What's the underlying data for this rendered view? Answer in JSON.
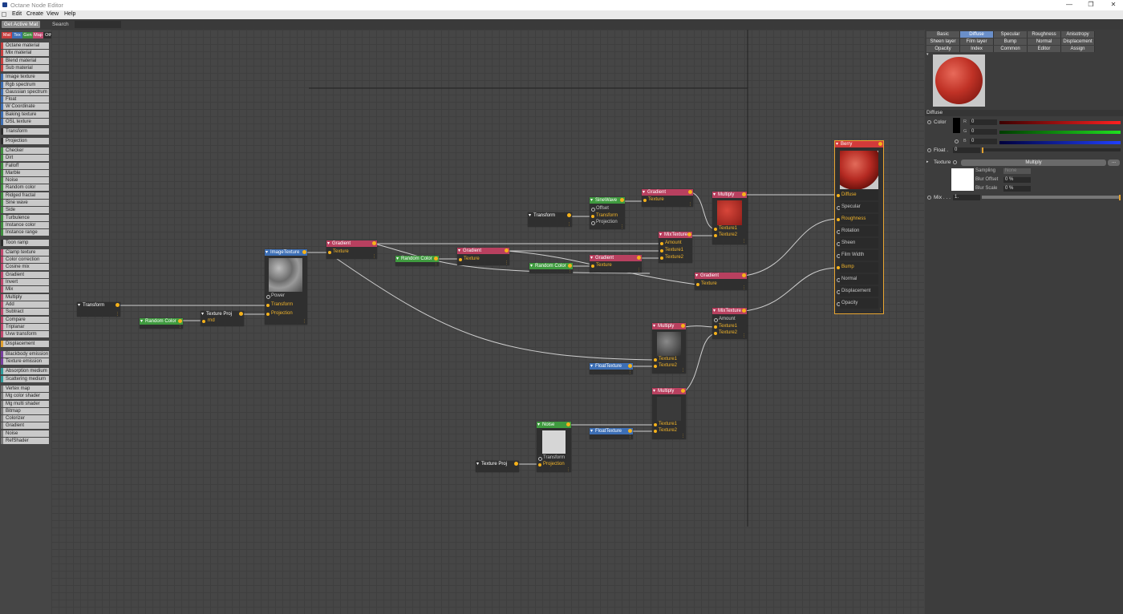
{
  "window": {
    "title": "Octane Node Editor",
    "controls": [
      "—",
      "❐",
      "✕"
    ]
  },
  "menubar": [
    "Edit",
    "Create",
    "View",
    "Help"
  ],
  "toolbar": {
    "get_active_label": "Get Active Mat",
    "search_label": "Search",
    "search_value": ""
  },
  "categories": [
    {
      "label": "Mat",
      "color": "#c94040"
    },
    {
      "label": "Tex",
      "color": "#3d6fb5"
    },
    {
      "label": "Gen",
      "color": "#3f8f3f"
    },
    {
      "label": "Map",
      "color": "#c0486e"
    },
    {
      "label": "Oth",
      "color": "#2c2c2c"
    },
    {
      "label": "Ems",
      "color": "#7a3fa0"
    },
    {
      "label": "Med",
      "color": "#2f9a9a"
    },
    {
      "label": "C4D",
      "color": "#7a7a7a"
    }
  ],
  "palette": [
    {
      "label": "Octane material",
      "color": "#c94040"
    },
    {
      "label": "Mix material",
      "color": "#c94040"
    },
    {
      "label": "Blend material",
      "color": "#c94040"
    },
    {
      "label": "Sub material",
      "color": "#c94040"
    },
    {
      "label": "Image texture",
      "color": "#3d6fb5"
    },
    {
      "label": "Rgb spectrum",
      "color": "#3d6fb5"
    },
    {
      "label": "Gaussian spectrum",
      "color": "#3d6fb5"
    },
    {
      "label": "Float",
      "color": "#3d6fb5"
    },
    {
      "label": "W Coordinate",
      "color": "#3d6fb5"
    },
    {
      "label": "Baking texture",
      "color": "#3d6fb5"
    },
    {
      "label": "OSL texture",
      "color": "#3d6fb5"
    },
    {
      "label": "Transform",
      "color": "#2c2c2c"
    },
    {
      "label": "Projection",
      "color": "#2c2c2c"
    },
    {
      "label": "Checker",
      "color": "#3f8f3f"
    },
    {
      "label": "Dirt",
      "color": "#3f8f3f"
    },
    {
      "label": "Falloff",
      "color": "#3f8f3f"
    },
    {
      "label": "Marble",
      "color": "#3f8f3f"
    },
    {
      "label": "Noise",
      "color": "#3f8f3f"
    },
    {
      "label": "Random color",
      "color": "#3f8f3f"
    },
    {
      "label": "Ridged fractal",
      "color": "#3f8f3f"
    },
    {
      "label": "Sine wave",
      "color": "#3f8f3f"
    },
    {
      "label": "Side",
      "color": "#3f8f3f"
    },
    {
      "label": "Turbulence",
      "color": "#3f8f3f"
    },
    {
      "label": "Instance color",
      "color": "#3f8f3f"
    },
    {
      "label": "Instance range",
      "color": "#3f8f3f"
    },
    {
      "label": "Toon ramp",
      "color": "#2c2c2c"
    },
    {
      "label": "Clamp texture",
      "color": "#c0486e"
    },
    {
      "label": "Color correction",
      "color": "#c0486e"
    },
    {
      "label": "Cosine mix",
      "color": "#c0486e"
    },
    {
      "label": "Gradient",
      "color": "#c0486e"
    },
    {
      "label": "Invert",
      "color": "#c0486e"
    },
    {
      "label": "Mix",
      "color": "#c0486e"
    },
    {
      "label": "Multiply",
      "color": "#c0486e"
    },
    {
      "label": "Add",
      "color": "#c0486e"
    },
    {
      "label": "Subtract",
      "color": "#c0486e"
    },
    {
      "label": "Compare",
      "color": "#c0486e"
    },
    {
      "label": "Triplanar",
      "color": "#c0486e"
    },
    {
      "label": "Uvw transform",
      "color": "#c0486e"
    },
    {
      "label": "Displacement",
      "color": "#e0a030"
    },
    {
      "label": "Blackbody emission",
      "color": "#7a3fa0"
    },
    {
      "label": "Texture emission",
      "color": "#7a3fa0"
    },
    {
      "label": "Absorption medium",
      "color": "#2f9a9a"
    },
    {
      "label": "Scattering medium",
      "color": "#2f9a9a"
    },
    {
      "label": "Vertex map",
      "color": "#7a7a7a"
    },
    {
      "label": "Mg color shader",
      "color": "#7a7a7a"
    },
    {
      "label": "Mg multi shader",
      "color": "#7a7a7a"
    },
    {
      "label": "Bitmap",
      "color": "#7a7a7a"
    },
    {
      "label": "Colorizer",
      "color": "#7a7a7a"
    },
    {
      "label": "Gradient",
      "color": "#7a7a7a"
    },
    {
      "label": "Noise",
      "color": "#7a7a7a"
    },
    {
      "label": "RefShader",
      "color": "#7a7a7a"
    }
  ],
  "nodes": {
    "transform_left": {
      "title": "Transform"
    },
    "random_color_1": {
      "title": "Random Color"
    },
    "texture_proj_1": {
      "title": "Texture Proj",
      "ports": [
        "rnd"
      ]
    },
    "image_texture": {
      "title": "ImageTexture",
      "ports": [
        "Power",
        "Transform",
        "Projection"
      ]
    },
    "gradient_1": {
      "title": "Gradient",
      "ports": [
        "Texture"
      ]
    },
    "random_color_2": {
      "title": "Random Color"
    },
    "gradient_2": {
      "title": "Gradient",
      "ports": [
        "Texture"
      ]
    },
    "random_color_3": {
      "title": "Random Color"
    },
    "gradient_3": {
      "title": "Gradient",
      "ports": [
        "Texture"
      ]
    },
    "transform_mid": {
      "title": "Transform"
    },
    "sinewave": {
      "title": "SineWave",
      "ports": [
        "Offset",
        "Transform",
        "Projection"
      ]
    },
    "gradient_4": {
      "title": "Gradient",
      "ports": [
        "Texture"
      ]
    },
    "multiply_top": {
      "title": "Multiply",
      "ports": [
        "Texture1",
        "Texture2"
      ]
    },
    "mixtexture_1": {
      "title": "MixTexture",
      "ports": [
        "Amount",
        "Texture1",
        "Texture2"
      ]
    },
    "gradient_5": {
      "title": "Gradient",
      "ports": [
        "Texture"
      ]
    },
    "mixtexture_2": {
      "title": "MixTexture",
      "ports": [
        "Amount",
        "Texture1",
        "Texture2"
      ]
    },
    "multiply_mid": {
      "title": "Multiply",
      "ports": [
        "Texture1",
        "Texture2"
      ]
    },
    "floattexture_1": {
      "title": "FloatTexture"
    },
    "multiply_low": {
      "title": "Multiply",
      "ports": [
        "Texture1",
        "Texture2"
      ]
    },
    "floattexture_2": {
      "title": "FloatTexture"
    },
    "noise": {
      "title": "Noise",
      "ports": [
        "Transform",
        "Projection"
      ]
    },
    "texture_proj_2": {
      "title": "Texture Proj"
    },
    "berry": {
      "title": "Berry",
      "ports": [
        "Diffuse",
        "Specular",
        "Roughness",
        "Rotation",
        "Sheen",
        "Film Width",
        "Bump",
        "Normal",
        "Displacement",
        "Opacity"
      ]
    }
  },
  "right_panel": {
    "tabs_row1": [
      "Basic",
      "Diffuse",
      "Specular",
      "Roughness",
      "Anisotropy"
    ],
    "tabs_row2": [
      "Sheen layer",
      "Film layer",
      "Bump",
      "Normal",
      "Displacement"
    ],
    "tabs_row3": [
      "Opacity",
      "Index",
      "Common",
      "Editor",
      "Assign"
    ],
    "active_tab": "Diffuse",
    "section_title": "Diffuse",
    "color_label": "Color",
    "r_label": "R",
    "r_value": "0",
    "g_label": "G",
    "g_value": "0",
    "b_label": "B",
    "b_value": "0",
    "float_label": "Float .",
    "float_value": "0",
    "texture_label": "Texture",
    "texture_value": "Multiply",
    "texture_more": "...",
    "sampling_label": "Sampling",
    "sampling_value": "None",
    "blur_offset_label": "Blur Offset",
    "blur_offset_value": "0 %",
    "blur_scale_label": "Blur Scale",
    "blur_scale_value": "0 %",
    "mix_label": "Mix . . .",
    "mix_value": "1."
  },
  "colors": {
    "material": "#d23a3a",
    "texture": "#3d6fb5",
    "generator": "#3f9a3f",
    "map": "#b8405f",
    "port_active": "#f3b52a",
    "active_tab": "#6a8fc9"
  }
}
